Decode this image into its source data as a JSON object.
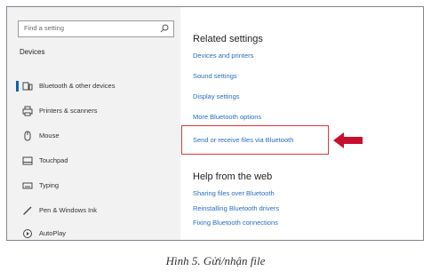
{
  "sidebar": {
    "search_placeholder": "Find a setting",
    "section_title": "Devices",
    "items": [
      {
        "label": "Bluetooth & other devices",
        "icon": "bluetooth-devices-icon",
        "selected": true
      },
      {
        "label": "Printers & scanners",
        "icon": "printer-icon"
      },
      {
        "label": "Mouse",
        "icon": "mouse-icon"
      },
      {
        "label": "Touchpad",
        "icon": "touchpad-icon"
      },
      {
        "label": "Typing",
        "icon": "keyboard-icon"
      },
      {
        "label": "Pen & Windows Ink",
        "icon": "pen-icon"
      },
      {
        "label": "AutoPlay",
        "icon": "autoplay-icon"
      }
    ]
  },
  "related": {
    "title": "Related settings",
    "links": [
      "Devices and printers",
      "Sound settings",
      "Display settings",
      "More Bluetooth options",
      "Send or receive files via Bluetooth"
    ]
  },
  "help": {
    "title": "Help from the web",
    "links": [
      "Sharing files over Bluetooth",
      "Reinstalling Bluetooth drivers",
      "Fixing Bluetooth connections"
    ]
  },
  "caption": "Hình 5. Gửi/nhận file",
  "colors": {
    "accent": "#0063b1",
    "link": "#2a6dc1",
    "highlight": "#d9363e"
  }
}
